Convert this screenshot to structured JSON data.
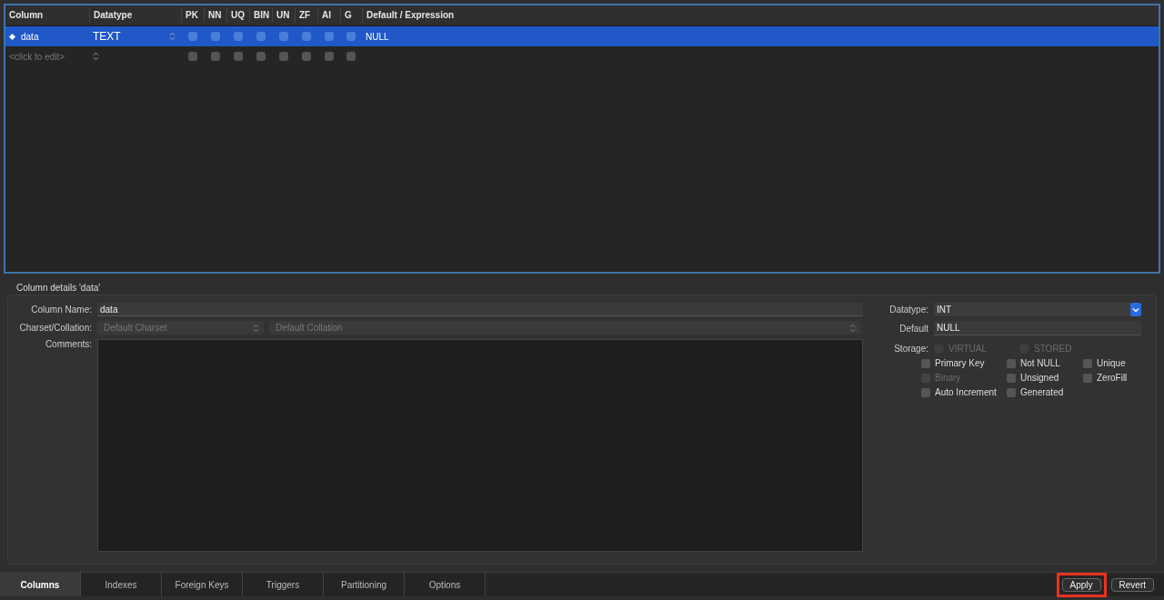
{
  "grid": {
    "columns": [
      "Column",
      "Datatype",
      "PK",
      "NN",
      "UQ",
      "BIN",
      "UN",
      "ZF",
      "AI",
      "G",
      "Default / Expression"
    ],
    "rows": [
      {
        "kind": "column",
        "selected": true,
        "name": "data",
        "datatype": "TEXT",
        "flags": [
          false,
          false,
          false,
          false,
          false,
          false,
          false,
          false
        ],
        "default": "NULL"
      },
      {
        "kind": "placeholder",
        "selected": false,
        "placeholder": "<click to edit>",
        "flags": [
          false,
          false,
          false,
          false,
          false,
          false,
          false,
          false
        ]
      }
    ]
  },
  "details": {
    "title": "Column details 'data'",
    "column_name": {
      "label": "Column Name:",
      "value": "data"
    },
    "charset": {
      "label": "Charset/Collation:",
      "charset": "Default Charset",
      "collation": "Default Collation"
    },
    "comments": {
      "label": "Comments:"
    },
    "datatype": {
      "label": "Datatype:",
      "value": "INT"
    },
    "default": {
      "label": "Default",
      "value": "NULL"
    },
    "storage": {
      "label": "Storage:",
      "options": [
        {
          "label": "VIRTUAL",
          "selected": false,
          "disabled": true
        },
        {
          "label": "STORED",
          "selected": false,
          "disabled": true
        }
      ]
    },
    "flags": [
      {
        "label": "Primary Key",
        "checked": false,
        "disabled": false
      },
      {
        "label": "Not NULL",
        "checked": false,
        "disabled": false
      },
      {
        "label": "Unique",
        "checked": false,
        "disabled": false
      },
      {
        "label": "Binary",
        "checked": false,
        "disabled": true
      },
      {
        "label": "Unsigned",
        "checked": false,
        "disabled": false
      },
      {
        "label": "ZeroFill",
        "checked": false,
        "disabled": false
      },
      {
        "label": "Auto Increment",
        "checked": false,
        "disabled": false
      },
      {
        "label": "Generated",
        "checked": false,
        "disabled": false
      }
    ]
  },
  "tabs": [
    {
      "label": "Columns",
      "selected": true
    },
    {
      "label": "Indexes",
      "selected": false
    },
    {
      "label": "Foreign Keys",
      "selected": false
    },
    {
      "label": "Triggers",
      "selected": false
    },
    {
      "label": "Partitioning",
      "selected": false
    },
    {
      "label": "Options",
      "selected": false
    }
  ],
  "buttons": [
    {
      "label": "Apply",
      "highlighted": true
    },
    {
      "label": "Revert",
      "highlighted": false
    }
  ]
}
